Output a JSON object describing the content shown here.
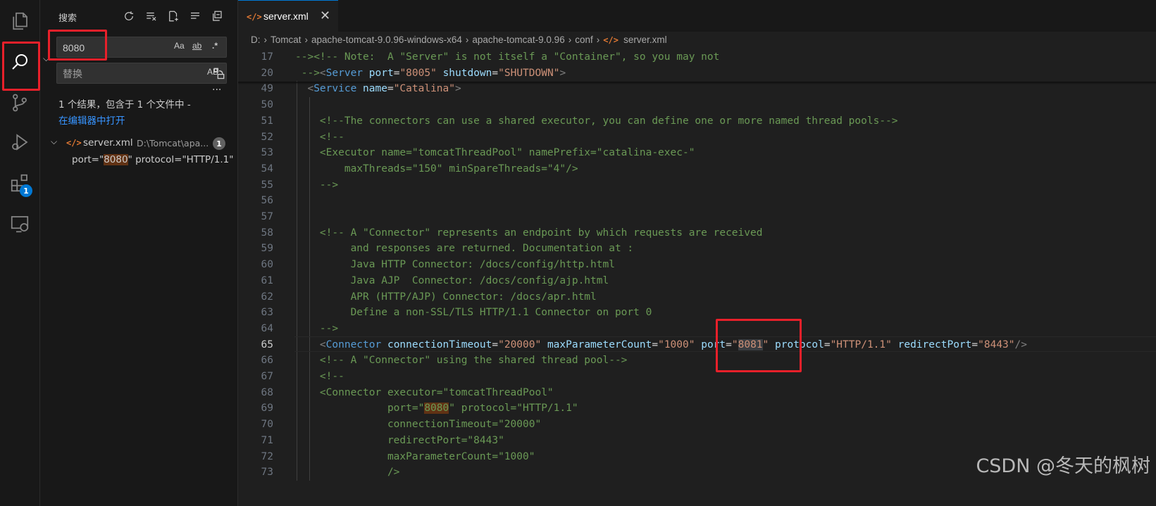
{
  "activity": {
    "items": [
      {
        "name": "explorer",
        "icon": "files-icon"
      },
      {
        "name": "search",
        "icon": "search-icon"
      },
      {
        "name": "source-control",
        "icon": "source-control-icon"
      },
      {
        "name": "run-debug",
        "icon": "run-debug-icon"
      },
      {
        "name": "extensions",
        "icon": "extensions-icon",
        "badge": "1"
      },
      {
        "name": "remote-explorer",
        "icon": "remote-explorer-icon"
      }
    ]
  },
  "sidebar": {
    "title": "搜索",
    "search": {
      "value": "8080",
      "opt_case": "Aa",
      "opt_word": "ab",
      "opt_regex": ".*"
    },
    "replace": {
      "placeholder": "替换",
      "opt_preserve": "AB"
    },
    "more": "...",
    "summary": "1 个结果，包含于 1 个文件中 -",
    "open_link": "在编辑器中打开",
    "file": {
      "name": "server.xml",
      "path": "D:\\Tomcat\\apa...",
      "count": "1"
    },
    "match": {
      "before": "port=\"",
      "hit": "8080",
      "after": "\" protocol=\"HTTP/1.1\""
    }
  },
  "editor": {
    "tab_label": "server.xml",
    "tab_close": "✕",
    "breadcrumb": [
      "D:",
      "Tomcat",
      "apache-tomcat-9.0.96-windows-x64",
      "apache-tomcat-9.0.96",
      "conf",
      "server.xml"
    ],
    "xml_icon": "</>",
    "lines": [
      {
        "n": "17",
        "text": "--><!-- Note:  A \"Server\" is not itself a \"Container\", so you may not"
      },
      {
        "n": "20",
        "text": " --><Server port=\"8005\" shutdown=\"SHUTDOWN\">"
      },
      {
        "n": "49",
        "text": "  <Service name=\"Catalina\">"
      },
      {
        "n": "50",
        "text": ""
      },
      {
        "n": "51",
        "text": "    <!--The connectors can use a shared executor, you can define one or more named thread pools-->"
      },
      {
        "n": "52",
        "text": "    <!--"
      },
      {
        "n": "53",
        "text": "    <Executor name=\"tomcatThreadPool\" namePrefix=\"catalina-exec-\""
      },
      {
        "n": "54",
        "text": "        maxThreads=\"150\" minSpareThreads=\"4\"/>"
      },
      {
        "n": "55",
        "text": "    -->"
      },
      {
        "n": "56",
        "text": ""
      },
      {
        "n": "57",
        "text": ""
      },
      {
        "n": "58",
        "text": "    <!-- A \"Connector\" represents an endpoint by which requests are received"
      },
      {
        "n": "59",
        "text": "         and responses are returned. Documentation at :"
      },
      {
        "n": "60",
        "text": "         Java HTTP Connector: /docs/config/http.html"
      },
      {
        "n": "61",
        "text": "         Java AJP  Connector: /docs/config/ajp.html"
      },
      {
        "n": "62",
        "text": "         APR (HTTP/AJP) Connector: /docs/apr.html"
      },
      {
        "n": "63",
        "text": "         Define a non-SSL/TLS HTTP/1.1 Connector on port 0"
      },
      {
        "n": "64",
        "text": "    -->"
      },
      {
        "n": "65",
        "text": "    <Connector connectionTimeout=\"20000\" maxParameterCount=\"1000\" port=\"8081\" protocol=\"HTTP/1.1\" redirectPort=\"8443\"/>"
      },
      {
        "n": "66",
        "text": "    <!-- A \"Connector\" using the shared thread pool-->"
      },
      {
        "n": "67",
        "text": "    <!--"
      },
      {
        "n": "68",
        "text": "    <Connector executor=\"tomcatThreadPool\""
      },
      {
        "n": "69",
        "text": "               port=\"8080\" protocol=\"HTTP/1.1\""
      },
      {
        "n": "70",
        "text": "               connectionTimeout=\"20000\""
      },
      {
        "n": "71",
        "text": "               redirectPort=\"8443\""
      },
      {
        "n": "72",
        "text": "               maxParameterCount=\"1000\""
      },
      {
        "n": "73",
        "text": "               />"
      }
    ]
  },
  "watermark": "CSDN @冬天的枫树",
  "colors": {
    "accent": "#0078d4",
    "highlight_box": "#e8202a",
    "comment": "#6a9955",
    "tag": "#569cd6",
    "attr": "#9cdcfe",
    "string": "#ce9178"
  }
}
